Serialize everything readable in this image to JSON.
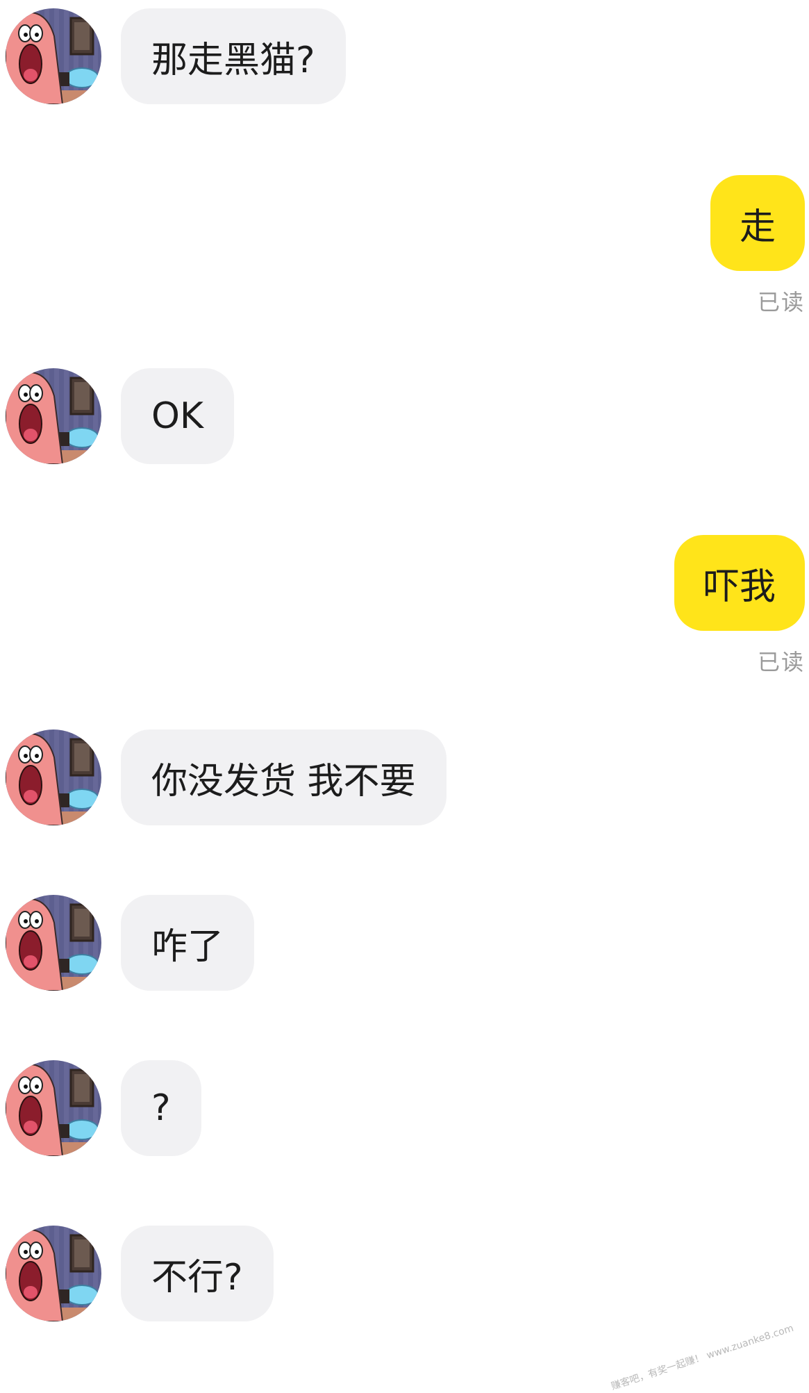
{
  "messages": [
    {
      "side": "in",
      "text": "那走黑猫?"
    },
    {
      "side": "out",
      "text": "走",
      "status": "已读"
    },
    {
      "side": "in",
      "text": "OK"
    },
    {
      "side": "out",
      "text": "吓我",
      "status": "已读"
    },
    {
      "side": "in",
      "text": "你没发货 我不要"
    },
    {
      "side": "in",
      "text": "咋了"
    },
    {
      "side": "in",
      "text": "?"
    },
    {
      "side": "in",
      "text": "不行?"
    }
  ],
  "watermark": {
    "text": "赚客吧，有奖一起赚！ www.zuanke8.com"
  },
  "colors": {
    "incoming_bubble": "#f1f1f3",
    "outgoing_bubble": "#ffe41a",
    "read_status": "#9a9a9a"
  },
  "icons": {
    "avatar": "patrick-star-avatar-icon"
  }
}
